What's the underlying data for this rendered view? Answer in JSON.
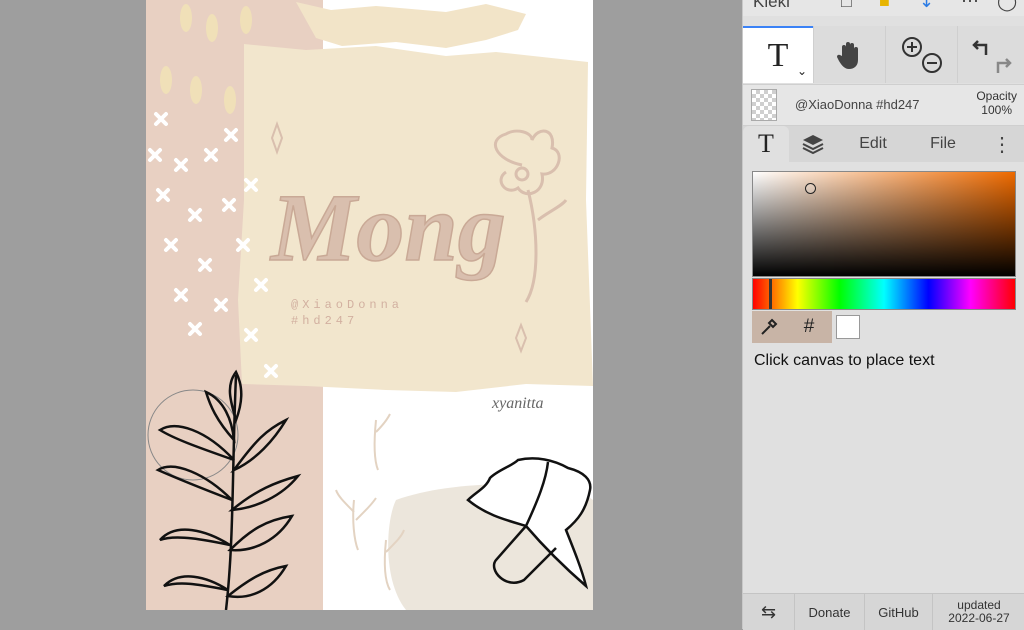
{
  "app": {
    "name": "Kleki"
  },
  "artwork": {
    "title": "Mong",
    "credit_line1": "@XiaoDonna",
    "credit_line2": "#hd247",
    "signature": "xyanitta"
  },
  "toolbar": {
    "brush_tool_icon": "T",
    "caret": "⌄",
    "hand_icon": "hand-icon",
    "zoom_in_icon": "zoom-in-icon",
    "zoom_out_icon": "zoom-out-icon",
    "undo_icon": "undo-icon",
    "redo_icon": "redo-icon"
  },
  "layer": {
    "name": "@XiaoDonna #hd247",
    "opacity_label": "Opacity",
    "opacity_value": "100%"
  },
  "tabs": {
    "text_tab": "T",
    "edit": "Edit",
    "file": "File",
    "more": "⋮"
  },
  "color": {
    "hex_label": "#",
    "current": "#ffffff",
    "hue_base": "#ee6a00"
  },
  "hint": "Click canvas to place text",
  "footer": {
    "swap": "⇆",
    "donate": "Donate",
    "github": "GitHub",
    "updated_label": "updated",
    "updated_date": "2022-06-27"
  }
}
